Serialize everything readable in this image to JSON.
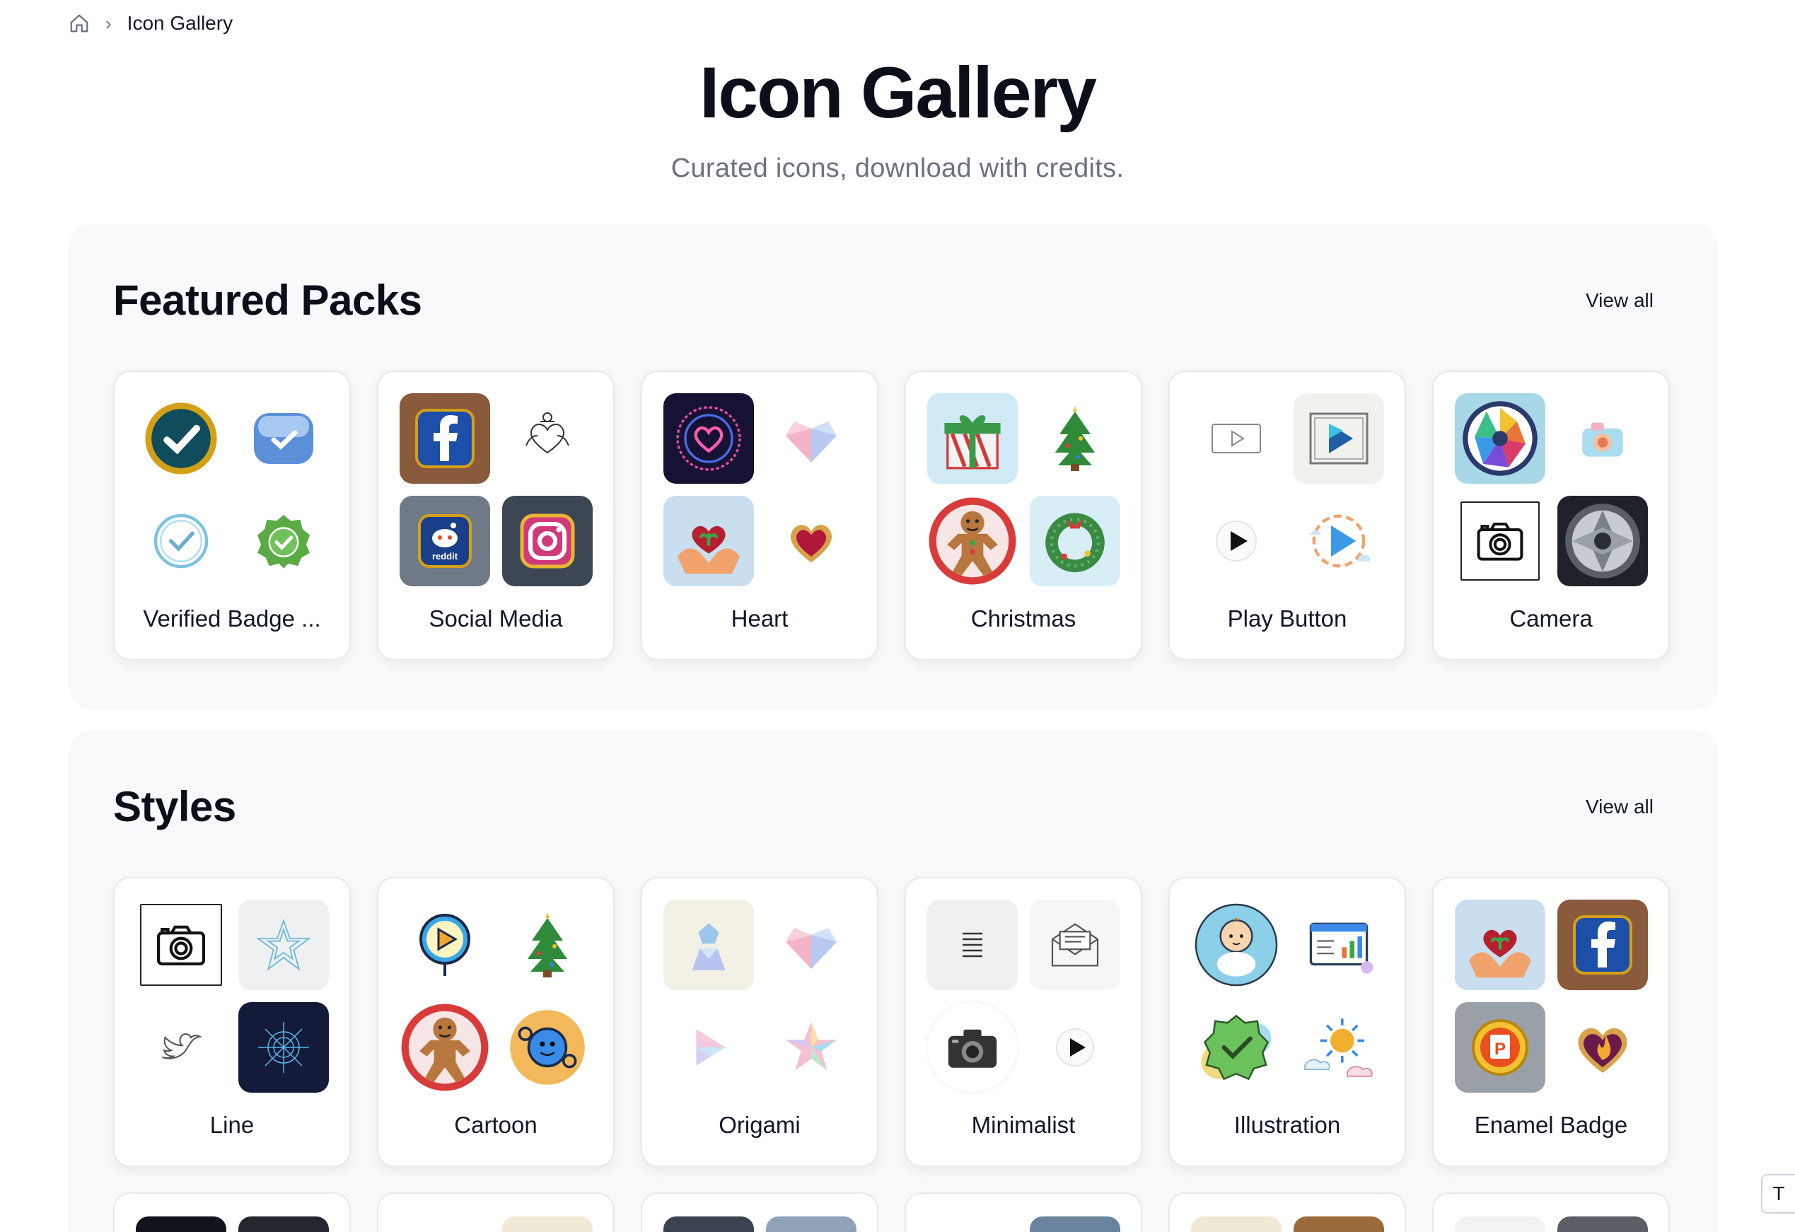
{
  "breadcrumb": {
    "current": "Icon Gallery"
  },
  "hero": {
    "title": "Icon Gallery",
    "subtitle": "Curated icons, download with credits."
  },
  "featured": {
    "title": "Featured Packs",
    "view_all": "View all",
    "cards": [
      {
        "label": "Verified Badge ...",
        "icons": [
          "gold-check-badge-icon",
          "glass-check-badge-icon",
          "outline-check-badge-icon",
          "green-check-badge-icon"
        ]
      },
      {
        "label": "Social Media",
        "icons": [
          "facebook-icon",
          "heart-hands-icon",
          "reddit-icon",
          "instagram-icon"
        ]
      },
      {
        "label": "Heart",
        "icons": [
          "neon-heart-icon",
          "origami-heart-icon",
          "hands-heart-plant-icon",
          "gem-heart-icon"
        ]
      },
      {
        "label": "Christmas",
        "icons": [
          "gift-box-icon",
          "christmas-tree-icon",
          "gingerbread-man-icon",
          "wreath-icon"
        ]
      },
      {
        "label": "Play Button",
        "icons": [
          "outline-play-icon",
          "square-play-icon",
          "round-play-icon",
          "cloud-play-icon"
        ]
      },
      {
        "label": "Camera",
        "icons": [
          "aperture-icon",
          "pastel-camera-icon",
          "line-camera-icon",
          "lens-shutter-icon"
        ]
      }
    ]
  },
  "styles": {
    "title": "Styles",
    "view_all": "View all",
    "cards": [
      {
        "label": "Line",
        "icons": [
          "line-camera-icon",
          "star-sketch-icon",
          "bird-icon",
          "brain-network-icon"
        ]
      },
      {
        "label": "Cartoon",
        "icons": [
          "play-balloon-icon",
          "christmas-tree-icon",
          "gingerbread-man-icon",
          "gear-character-icon"
        ]
      },
      {
        "label": "Origami",
        "icons": [
          "origami-person-icon",
          "origami-heart-icon",
          "origami-play-icon",
          "origami-star-icon"
        ]
      },
      {
        "label": "Minimalist",
        "icons": [
          "document-lines-icon",
          "envelope-icon",
          "camera-icon",
          "play-circle-icon"
        ]
      },
      {
        "label": "Illustration",
        "icons": [
          "baby-icon",
          "dashboard-chart-icon",
          "check-badge-icon",
          "sun-clouds-icon"
        ]
      },
      {
        "label": "Enamel Badge",
        "icons": [
          "hands-heart-plant-icon",
          "facebook-icon",
          "powerpoint-icon",
          "flame-heart-icon"
        ]
      }
    ]
  },
  "side_tab": {
    "label": "T"
  },
  "colors": {
    "section_bg": "#f8f9fa",
    "card_border": "#e8e9ec",
    "text": "#111827",
    "muted": "#6b7280"
  }
}
